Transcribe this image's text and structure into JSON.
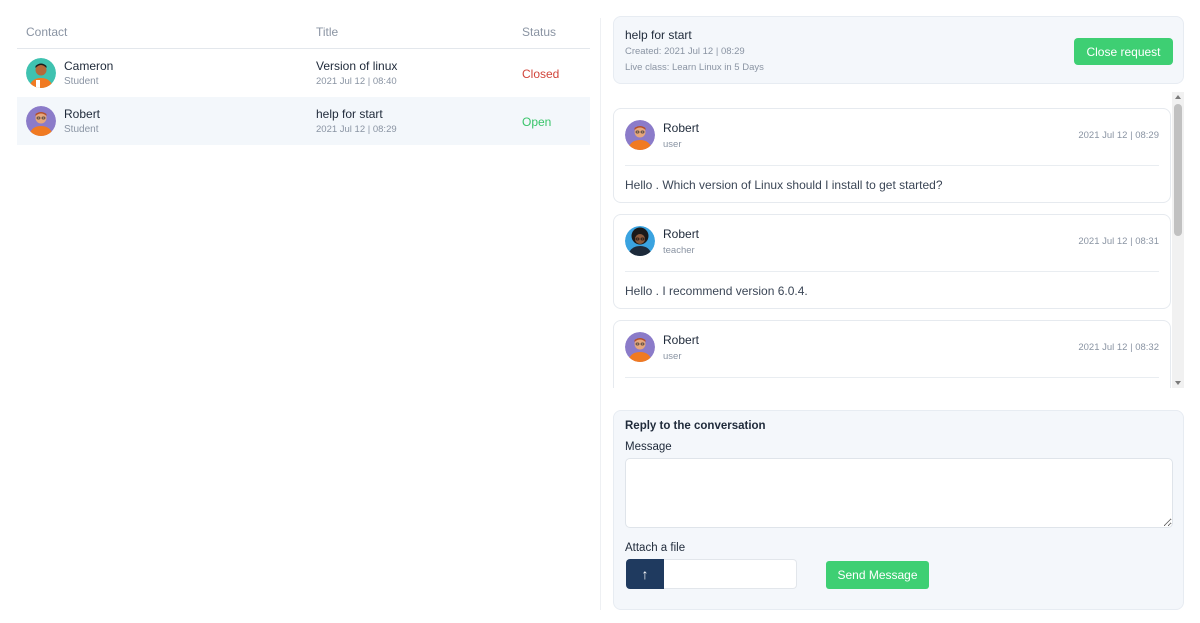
{
  "table": {
    "headers": {
      "contact": "Contact",
      "title": "Title",
      "status": "Status"
    },
    "rows": [
      {
        "name": "Cameron",
        "role": "Student",
        "title": "Version of linux",
        "date": "2021 Jul 12 | 08:40",
        "status": "Closed"
      },
      {
        "name": "Robert",
        "role": "Student",
        "title": "help for start",
        "date": "2021 Jul 12 | 08:29",
        "status": "Open"
      }
    ]
  },
  "request": {
    "title": "help for start",
    "created": "Created: 2021 Jul 12 | 08:29",
    "live_class": "Live class: Learn Linux in 5 Days",
    "close_label": "Close request"
  },
  "messages": [
    {
      "name": "Robert",
      "role": "user",
      "date": "2021 Jul 12 | 08:29",
      "text": "Hello . Which version of Linux should I install to get started?"
    },
    {
      "name": "Robert",
      "role": "teacher",
      "date": "2021 Jul 12 | 08:31",
      "text": "Hello . I recommend version 6.0.4."
    },
    {
      "name": "Robert",
      "role": "user",
      "date": "2021 Jul 12 | 08:32",
      "text": ""
    }
  ],
  "reply": {
    "title": "Reply to the conversation",
    "message_label": "Message",
    "message_value": "",
    "attach_label": "Attach a file",
    "send_label": "Send Message"
  },
  "icons": {
    "upload": "arrow-up-icon"
  },
  "colors": {
    "accent_green": "#3ecf73",
    "closed_red": "#d1453b",
    "open_green": "#39c46a",
    "navy": "#1f3a5f"
  }
}
